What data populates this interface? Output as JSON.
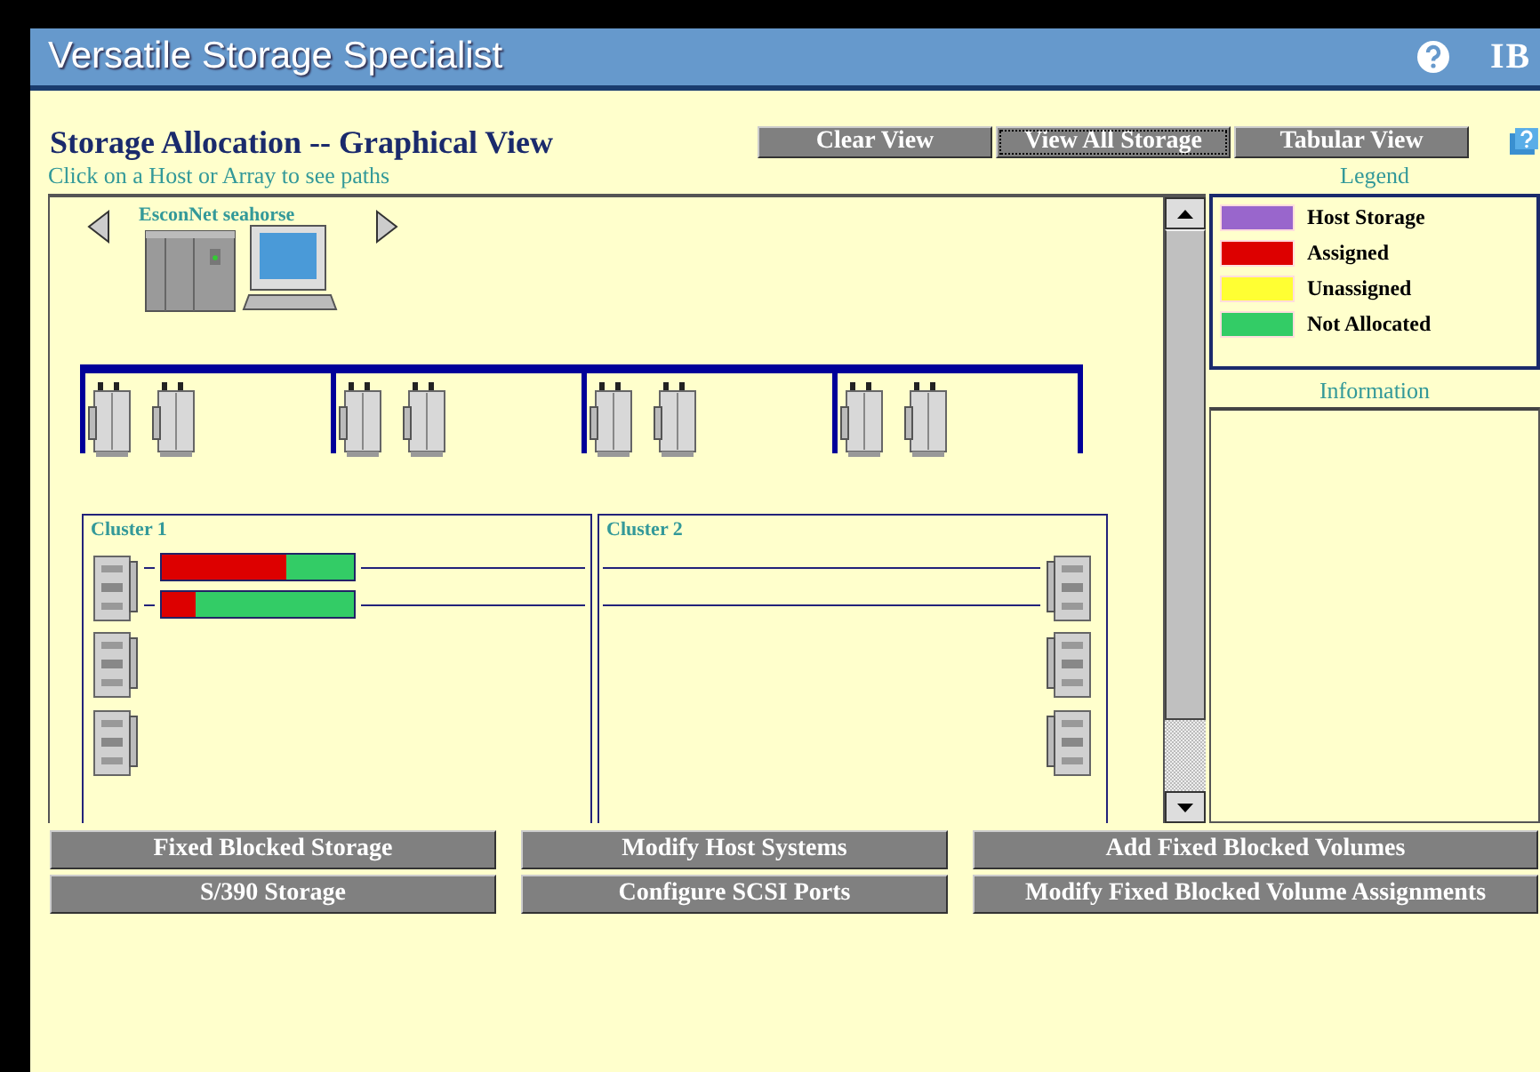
{
  "app": {
    "title": "Versatile Storage Specialist",
    "logo": "IB"
  },
  "page": {
    "title": "Storage Allocation -- Graphical View",
    "subtitle": "Click on a Host or Array to see paths"
  },
  "view_buttons": [
    {
      "label": "Clear View",
      "focused": false
    },
    {
      "label": "View All Storage",
      "focused": true
    },
    {
      "label": "Tabular View",
      "focused": false
    }
  ],
  "host": {
    "label": "EsconNet seahorse"
  },
  "clusters": [
    {
      "label": "Cluster 1",
      "kind": "left"
    },
    {
      "label": "Cluster 2",
      "kind": "right"
    }
  ],
  "paths": [
    {
      "level": 0.65
    },
    {
      "level": 0.18
    }
  ],
  "legend": {
    "title": "Legend",
    "items": [
      {
        "label": "Host Storage",
        "color": "#9966cc"
      },
      {
        "label": "Assigned",
        "color": "#dd0000"
      },
      {
        "label": "Unassigned",
        "color": "#ffff33"
      },
      {
        "label": "Not Allocated",
        "color": "#33cc66"
      }
    ]
  },
  "information": {
    "title": "Information"
  },
  "actions": [
    "Fixed Blocked Storage",
    "Modify Host Systems",
    "Add Fixed Blocked Volumes",
    "S/390 Storage",
    "Configure SCSI Ports",
    "Modify Fixed Blocked Volume Assignments"
  ]
}
